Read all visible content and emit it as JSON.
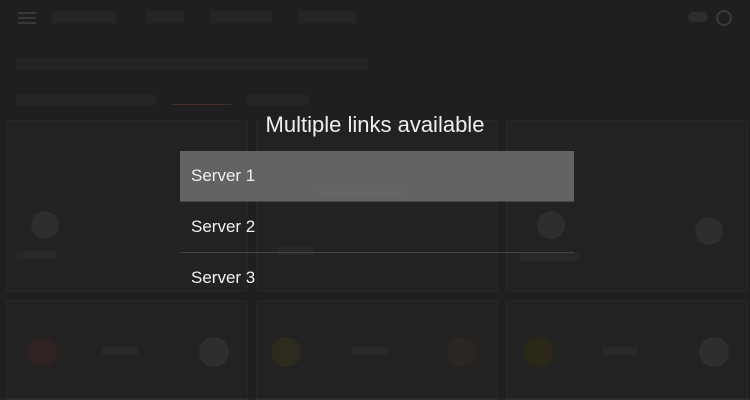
{
  "dialog": {
    "title": "Multiple links available",
    "options": [
      "Server 1",
      "Server 2",
      "Server 3"
    ],
    "selected_index": 0
  },
  "colors": {
    "background": "#262626",
    "selected_option": "#7d7d7d",
    "text": "#f0f0f0"
  }
}
